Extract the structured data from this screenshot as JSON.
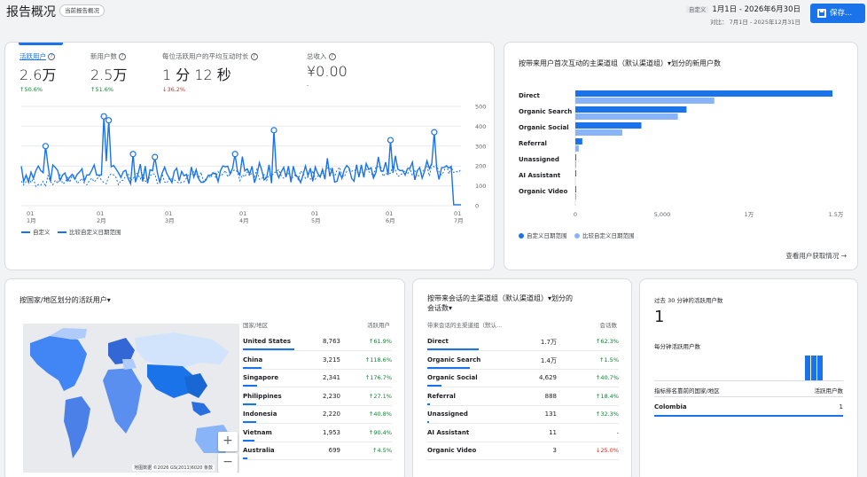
{
  "header": {
    "title": "报告概况",
    "report_chip": "当前报告概况",
    "date_label": "自定义",
    "date_range": "1月1日 - 2026年6月30日",
    "compare_range": "对比： 7月1日 - 2025年12月31日",
    "save_label": "保存..."
  },
  "metrics": [
    {
      "label": "活跃用户",
      "value": "2.6万",
      "change": "↑50.6%",
      "dir": "up"
    },
    {
      "label": "新用户数",
      "value": "2.5万",
      "change": "↑51.6%",
      "dir": "up"
    },
    {
      "label": "每位活跃用户的平均互动时长",
      "value": "1 分 12 秒",
      "change": "↓36.2%",
      "dir": "down"
    },
    {
      "label": "总收入",
      "value": "¥0.00",
      "change": "-",
      "dir": "none"
    }
  ],
  "main_chart": {
    "y_ticks": [
      "500",
      "400",
      "300",
      "200",
      "100",
      "0"
    ],
    "x_ticks": [
      {
        "day": "01",
        "month": "1月"
      },
      {
        "day": "01",
        "month": "2月"
      },
      {
        "day": "01",
        "month": "3月"
      },
      {
        "day": "01",
        "month": "4月"
      },
      {
        "day": "01",
        "month": "5月"
      },
      {
        "day": "01",
        "month": "6月"
      },
      {
        "day": "01",
        "month": "7月"
      }
    ],
    "legend_current": "自定义",
    "legend_compare": "比较自定义日期范围"
  },
  "channel_card": {
    "title": "按带来用户首次互动的主渠道组（默认渠道组）▾划分的新用户数",
    "x_ticks": [
      "0",
      "5,000",
      "1万",
      "1.5万"
    ],
    "legend_current": "自定义日期范围",
    "legend_compare": "比较自定义日期范围",
    "link": "查看用户获取情况 →"
  },
  "chart_data": {
    "type": "bar",
    "orientation": "horizontal",
    "categories": [
      "Direct",
      "Organic Search",
      "Organic Social",
      "Referral",
      "Unassigned",
      "AI Assistant",
      "Organic Video"
    ],
    "series": [
      {
        "name": "自定义日期范围",
        "values": [
          14800,
          6400,
          3800,
          400,
          30,
          10,
          10
        ]
      },
      {
        "name": "比较自定义日期范围",
        "values": [
          8000,
          5900,
          2700,
          200,
          40,
          0,
          5
        ]
      }
    ],
    "xlim": [
      0,
      15000
    ]
  },
  "country_card": {
    "title": "按国家/地区划分的活跃用户▾",
    "col_name": "国家/地区",
    "col_value": "活跃用户",
    "map_credit": "地图数据 ©2026 GS(2011)6020",
    "map_terms": "条款",
    "zoom_in": "+",
    "zoom_out": "−",
    "rows": [
      {
        "name": "United States",
        "value": "8,763",
        "change": "↑61.9%",
        "dir": "up",
        "share": 1.0
      },
      {
        "name": "China",
        "value": "3,215",
        "change": "↑118.6%",
        "dir": "up",
        "share": 0.37
      },
      {
        "name": "Singapore",
        "value": "2,341",
        "change": "↑176.7%",
        "dir": "up",
        "share": 0.27
      },
      {
        "name": "Philippines",
        "value": "2,230",
        "change": "↑27.1%",
        "dir": "up",
        "share": 0.25
      },
      {
        "name": "Indonesia",
        "value": "2,220",
        "change": "↑40.8%",
        "dir": "up",
        "share": 0.25
      },
      {
        "name": "Vietnam",
        "value": "1,953",
        "change": "↑90.4%",
        "dir": "up",
        "share": 0.22
      },
      {
        "name": "Australia",
        "value": "699",
        "change": "↑4.5%",
        "dir": "up",
        "share": 0.08
      }
    ]
  },
  "session_card": {
    "title_line1": "按带来会话的主渠道组（默认渠道组）▾划分的",
    "title_line2": "会话数▾",
    "col_name": "带来会话的主渠道组（默认...",
    "col_value": "会话数",
    "rows": [
      {
        "name": "Direct",
        "value": "1.7万",
        "change": "↑62.3%",
        "dir": "up",
        "share": 1.0
      },
      {
        "name": "Organic Search",
        "value": "1.4万",
        "change": "↑1.5%",
        "dir": "up",
        "share": 0.82
      },
      {
        "name": "Organic Social",
        "value": "4,629",
        "change": "↑40.7%",
        "dir": "up",
        "share": 0.27
      },
      {
        "name": "Referral",
        "value": "888",
        "change": "↑18.4%",
        "dir": "up",
        "share": 0.05
      },
      {
        "name": "Unassigned",
        "value": "131",
        "change": "↑32.3%",
        "dir": "up",
        "share": 0.01
      },
      {
        "name": "AI Assistant",
        "value": "11",
        "change": "-",
        "dir": "none",
        "share": 0.0
      },
      {
        "name": "Organic Video",
        "value": "3",
        "change": "↓25.0%",
        "dir": "down",
        "share": 0.0
      }
    ]
  },
  "realtime_card": {
    "title": "过去 30 分钟的活跃用户数",
    "value": "1",
    "per_minute_label": "每分钟活跃用户数",
    "col_name": "指标排名靠前的国家/地区",
    "col_value": "活跃用户数",
    "row_name": "Colombia",
    "row_value": "1"
  },
  "colors": {
    "primary": "#1a73e8",
    "compare": "#8ab4f8",
    "up": "#188038",
    "down": "#d93025"
  }
}
